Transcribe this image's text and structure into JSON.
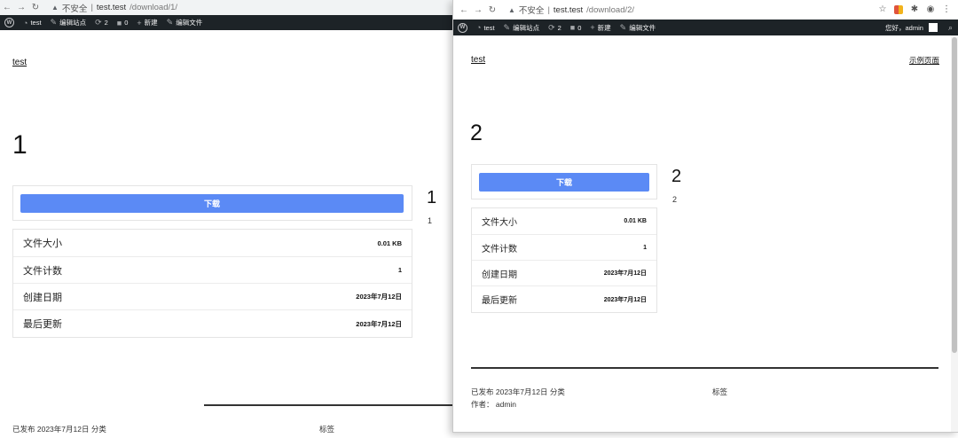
{
  "window1": {
    "url_warning": "不安全",
    "url_host": "test.test",
    "url_path": "/download/1/",
    "adminbar": {
      "site": "test",
      "edit_site": "编辑站点",
      "updates": "2",
      "comments": "0",
      "new": "新建",
      "edit_file": "编辑文件"
    },
    "site_title": "test",
    "heading": "1",
    "download_label": "下载",
    "side_number": "1",
    "side_sub": "1",
    "info": [
      {
        "label": "文件大小",
        "value": "0.01 KB"
      },
      {
        "label": "文件计数",
        "value": "1"
      },
      {
        "label": "创建日期",
        "value": "2023年7月12日"
      },
      {
        "label": "最后更新",
        "value": "2023年7月12日"
      }
    ],
    "footer_published": "已发布 2023年7月12日 分类",
    "footer_tags": "标签"
  },
  "window2": {
    "url_warning": "不安全",
    "url_host": "test.test",
    "url_path": "/download/2/",
    "adminbar": {
      "site": "test",
      "edit_site": "编辑站点",
      "updates": "2",
      "comments": "0",
      "new": "新建",
      "edit_file": "编辑文件",
      "greeting": "您好，admin"
    },
    "site_title": "test",
    "sample_page": "示例页面",
    "heading": "2",
    "download_label": "下载",
    "side_number": "2",
    "side_sub": "2",
    "info": [
      {
        "label": "文件大小",
        "value": "0.01 KB"
      },
      {
        "label": "文件计数",
        "value": "1"
      },
      {
        "label": "创建日期",
        "value": "2023年7月12日"
      },
      {
        "label": "最后更新",
        "value": "2023年7月12日"
      }
    ],
    "footer_published": "已发布 2023年7月12日 分类",
    "footer_tags": "标签",
    "footer_author": "作者：  admin"
  },
  "colors": {
    "download_button": "#5b8af5",
    "adminbar": "#1d2327"
  },
  "icons": [
    "back-arrow-icon",
    "forward-arrow-icon",
    "reload-icon",
    "warning-icon",
    "star-icon",
    "extension-icon",
    "puzzle-icon",
    "profile-icon",
    "menu-icon",
    "wordpress-icon",
    "dashboard-icon",
    "brush-icon",
    "updates-icon",
    "comment-icon",
    "plus-icon",
    "pencil-icon",
    "search-icon"
  ]
}
